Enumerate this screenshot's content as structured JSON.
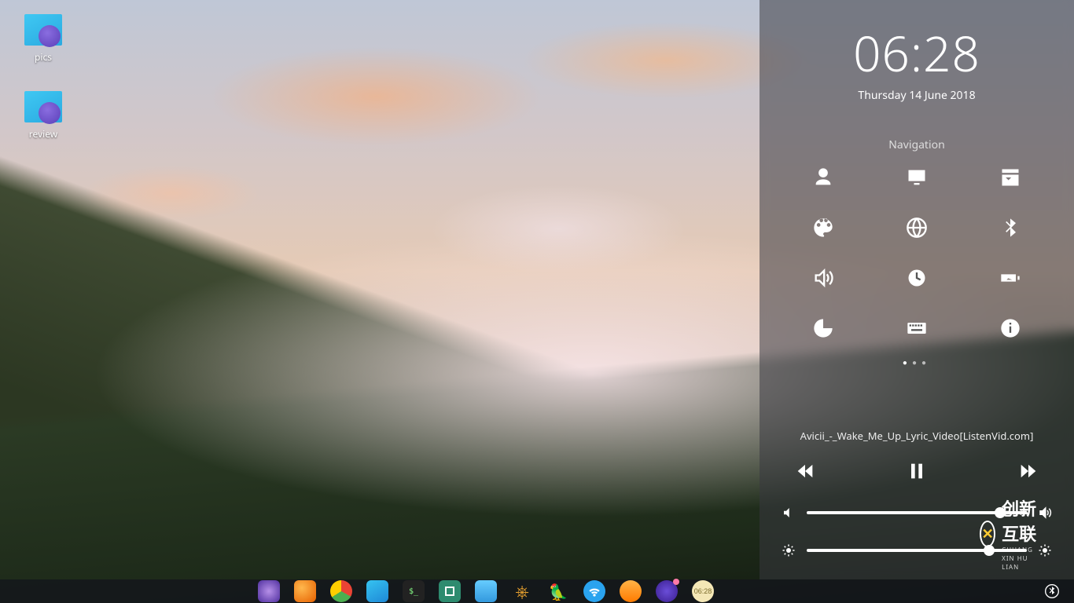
{
  "desktop": {
    "icons": [
      {
        "name": "pics",
        "label": "pics"
      },
      {
        "name": "review",
        "label": "review"
      }
    ]
  },
  "panel": {
    "time": "06:28",
    "date": "Thursday 14 June 2018",
    "navigation_title": "Navigation",
    "nav_items": [
      "user",
      "display",
      "application",
      "appearance",
      "network",
      "bluetooth",
      "volume",
      "clock",
      "battery",
      "storage",
      "keyboard",
      "info"
    ],
    "pager": {
      "pages": 3,
      "active_index": 0
    },
    "media": {
      "track": "Avicii_-_Wake_Me_Up_Lyric_Video[ListenVid.com]",
      "volume_percent": 88,
      "brightness_percent": 83
    }
  },
  "taskbar": {
    "items": [
      "app-launcher",
      "firefox",
      "chrome",
      "file-manager",
      "terminal",
      "window-list",
      "image-viewer",
      "steering",
      "bird-app",
      "wifi",
      "orange-app",
      "disc",
      "system-clock"
    ]
  },
  "tray": {
    "items": [
      "bluetooth"
    ],
    "brand": {
      "cn": "创新互联",
      "en": "CHUANG XIN HU LIAN"
    }
  }
}
